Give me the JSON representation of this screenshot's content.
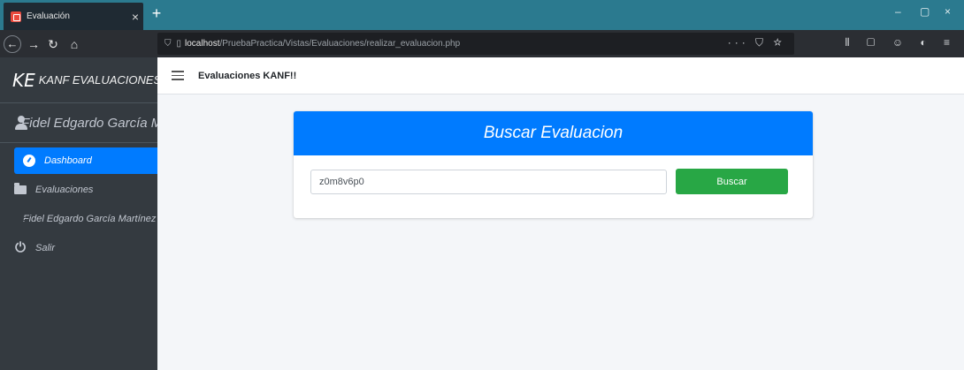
{
  "browser": {
    "tab_title": "Evaluación",
    "tab_close": "×",
    "new_tab": "+",
    "url_host": "localhost",
    "url_path": "/PruebaPractica/Vistas/Evaluaciones/realizar_evaluacion.php",
    "window_controls": {
      "minimize": "–",
      "maximize": "▢",
      "close": "×"
    },
    "url_actions": "··· ⛉ ☆",
    "toolbar_icons": "⫴ ▢ ☺ ◐ ≡"
  },
  "sidebar": {
    "brand_logo": "KE",
    "brand_text": "KANF EVALUACIONES!!",
    "user_name": "Fidel Edgardo García Martínez",
    "items": [
      {
        "label": "Dashboard",
        "icon": "dashboard-icon",
        "active": true
      },
      {
        "label": "Evaluaciones",
        "icon": "folder-icon",
        "active": false
      },
      {
        "label": "Fidel Edgardo García Martínez",
        "icon": "id-card-icon",
        "active": false
      },
      {
        "label": "Salir",
        "icon": "power-icon",
        "active": false
      }
    ]
  },
  "header": {
    "title": "Evaluaciones KANF!!"
  },
  "card": {
    "title": "Buscar Evaluacion",
    "search_value": "z0m8v6p0",
    "button_label": "Buscar"
  },
  "colors": {
    "primary": "#007bff",
    "success": "#28a745",
    "sidebar_bg": "#343a40",
    "tabbar_bg": "#2b7a8f"
  }
}
